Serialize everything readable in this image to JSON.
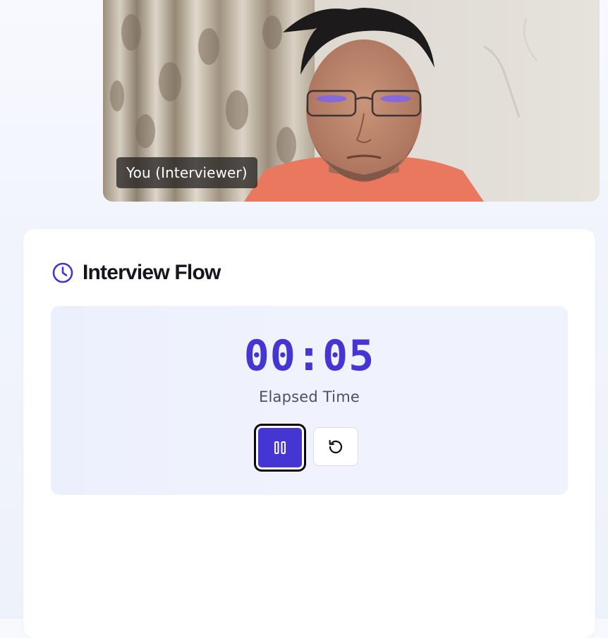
{
  "video": {
    "participant_label": "You (Interviewer)"
  },
  "flow_panel": {
    "title": "Interview Flow",
    "timer": {
      "value": "00:05",
      "caption": "Elapsed Time"
    },
    "controls": {
      "pause_icon": "pause-icon",
      "reset_icon": "rotate-ccw-icon"
    }
  },
  "colors": {
    "accent": "#4535d2",
    "panel_bg": "#eef1fd",
    "label_bg": "#28242 2"
  }
}
